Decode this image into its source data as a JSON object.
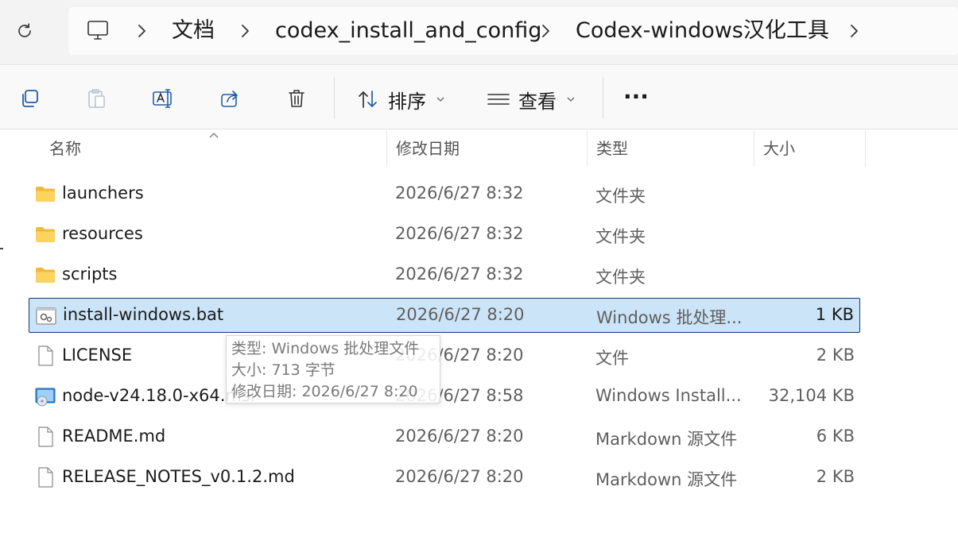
{
  "breadcrumb": {
    "items": [
      "文档",
      "codex_install_and_config",
      "Codex-windows汉化工具"
    ]
  },
  "toolbar": {
    "sort_label": "排序",
    "view_label": "查看",
    "more_label": "···"
  },
  "columns": {
    "name": "名称",
    "date": "修改日期",
    "type": "类型",
    "size": "大小"
  },
  "files": [
    {
      "name": "launchers",
      "date": "2026/6/27 8:32",
      "type": "文件夹",
      "size": "",
      "icon": "folder-icon"
    },
    {
      "name": "resources",
      "date": "2026/6/27 8:32",
      "type": "文件夹",
      "size": "",
      "icon": "folder-icon"
    },
    {
      "name": "scripts",
      "date": "2026/6/27 8:32",
      "type": "文件夹",
      "size": "",
      "icon": "folder-icon"
    },
    {
      "name": "install-windows.bat",
      "date": "2026/6/27 8:20",
      "type": "Windows 批处理...",
      "size": "1 KB",
      "icon": "batch-file-icon",
      "selected": true
    },
    {
      "name": "LICENSE",
      "date": "2026/6/27 8:20",
      "type": "文件",
      "size": "2 KB",
      "icon": "file-icon"
    },
    {
      "name": "node-v24.18.0-x64.msi",
      "date": "2026/6/27 8:58",
      "type": "Windows Install...",
      "size": "32,104 KB",
      "icon": "installer-icon"
    },
    {
      "name": "README.md",
      "date": "2026/6/27 8:20",
      "type": "Markdown 源文件",
      "size": "6 KB",
      "icon": "file-icon"
    },
    {
      "name": "RELEASE_NOTES_v0.1.2.md",
      "date": "2026/6/27 8:20",
      "type": "Markdown 源文件",
      "size": "2 KB",
      "icon": "file-icon"
    }
  ],
  "tooltip": {
    "type_line": "类型: Windows 批处理文件",
    "size_line": "大小: 713 字节",
    "date_line": "修改日期: 2026/6/27 8:20"
  },
  "colors": {
    "selection_bg": "#cce4f7",
    "selection_border": "#0a3b6e",
    "folder": "#f7c948"
  }
}
